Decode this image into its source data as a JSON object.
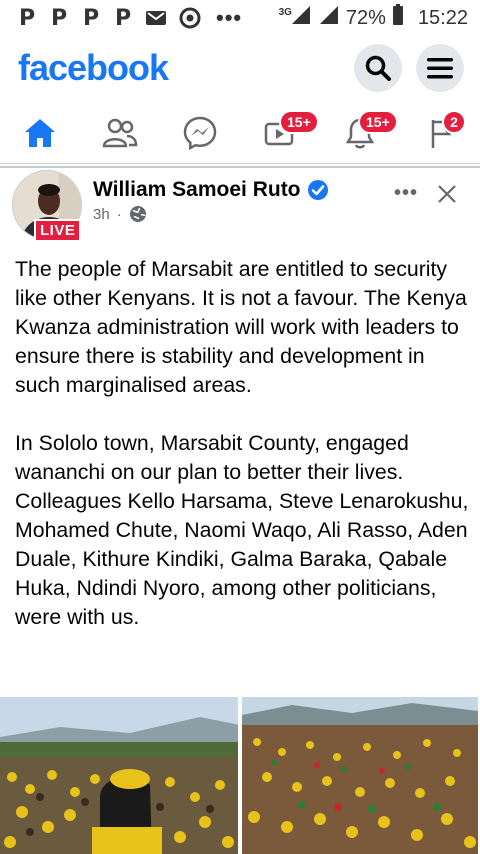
{
  "status_bar": {
    "notifications": [
      "P",
      "P",
      "P",
      "P"
    ],
    "overflow": "•••",
    "network": "3G",
    "battery": "72%",
    "time": "15:22",
    "icons": [
      "gmail-icon",
      "chrome-icon",
      "signal-icon",
      "battery-icon"
    ]
  },
  "header": {
    "logo": "facebook",
    "buttons": [
      "search-icon",
      "menu-icon"
    ]
  },
  "nav": {
    "tabs": [
      {
        "name": "home",
        "icon": "home-icon",
        "active": true
      },
      {
        "name": "friends",
        "icon": "friends-icon"
      },
      {
        "name": "messenger",
        "icon": "messenger-icon"
      },
      {
        "name": "watch",
        "icon": "watch-icon",
        "badge": "15+"
      },
      {
        "name": "notifications",
        "icon": "bell-icon",
        "badge": "15+"
      },
      {
        "name": "pages",
        "icon": "flag-icon",
        "badge": "2"
      }
    ],
    "active_color": "#1877f2",
    "badge_color": "#e41e3f"
  },
  "post": {
    "author": "William Samoei Ruto",
    "verified": true,
    "live_label": "LIVE",
    "time": "3h",
    "separator": "·",
    "privacy_icon": "globe-icon",
    "more_label": "•••",
    "paragraph_1": "The people of Marsabit are entitled to security like other Kenyans. It is not a favour. The Kenya Kwanza administration will work with leaders to ensure there is stability and development in such marginalised areas.",
    "paragraph_2": "In Sololo town, Marsabit County, engaged wananchi on our plan to better their lives. Colleagues Kello Harsama, Steve Lenarokushu, Mohamed Chute, Naomi Waqo, Ali Rasso, Aden Duale, Kithure Kindiki, Galma Baraka, Qabale Huka, Ndindi Nyoro, among other politicians, were with us.",
    "photos": [
      "rally-crowd-photo",
      "rally-crowd-photo"
    ]
  }
}
